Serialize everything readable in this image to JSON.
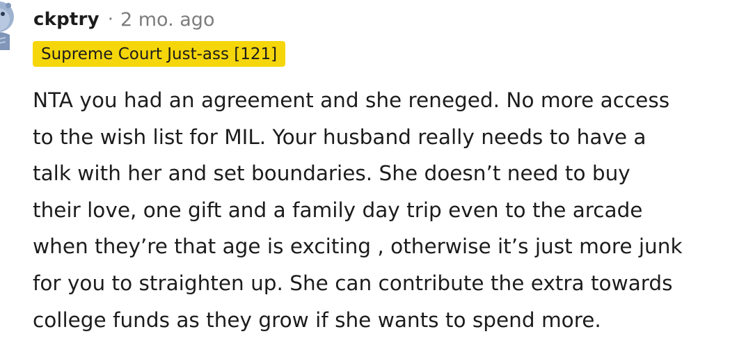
{
  "comment": {
    "author": "ckptry",
    "separator": "·",
    "age": "2 mo. ago",
    "flair": "Supreme Court Just-ass [121]",
    "body_lines": [
      "NTA you had an agreement and she reneged. No more access",
      "to the wish list for MIL. Your husband really needs to have a",
      "talk with her and set boundaries. She doesn’t need to buy",
      "their love, one gift and a family day trip even to the arcade",
      "when they’re that age is exciting , otherwise it’s just more junk",
      "for you to straighten up. She can contribute the extra towards",
      "college funds as they grow if she wants to spend more."
    ]
  },
  "avatar": {
    "icon": "snoo-avatar-icon",
    "colors": {
      "primary": "#9fb3d1",
      "shade": "#7f96b8",
      "eye": "#2c3a52"
    }
  },
  "colors": {
    "flair_background": "#f5d60a",
    "text": "#1c1c1c",
    "muted": "#7c7c7c"
  }
}
